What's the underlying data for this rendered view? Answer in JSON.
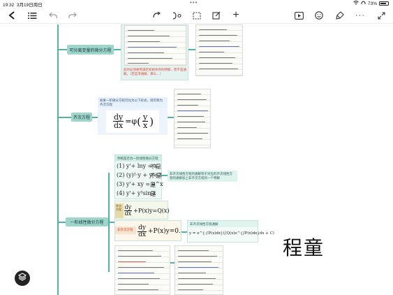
{
  "status": {
    "time": "19:32",
    "date": "3月19日周日",
    "battery": "73%"
  },
  "toolbar": {
    "back": "‹",
    "outline": "☰",
    "undo": "↶",
    "redo": "↷",
    "add": "+",
    "more": "···"
  },
  "topics": {
    "t1": "可分离变量的微分方程",
    "t2": "齐次方程",
    "t3": "一阶线性微分方程"
  },
  "notes": {
    "t1_red": "此时必须要用满足初始条件的特解，而不是通解。（若是求通解，那么…）",
    "t2_desc": "如果一阶微分方程可化为以下形式，则可称为齐次方程",
    "t3_header": "判断是否为一阶线性微分方程",
    "t3_note1": "非齐次线性方程的通解等于对应的齐次线性方程的通解加上非齐次方程的一个特解",
    "t3_homog": "齐次方程",
    "t3_homog2": "非齐次方程",
    "t3_general": "非齐次线性方程通解"
  },
  "formulas": {
    "homog_lhs_num": "dy",
    "homog_lhs_den": "dx",
    "homog_eq": "=φ",
    "homog_rhs_num": "y",
    "homog_rhs_den": "x",
    "linear_num": "dy",
    "linear_den": "dx",
    "linear_rest": "+P(x)y=Q(x)",
    "linear0_rest": "+P(x)y=0.",
    "general": "y = e^{-∫P(x)dx}(∫Q(x)e^{∫P(x)dx}dx + C)"
  },
  "checklist": [
    {
      "eq": "(1) y'+ lny = x",
      "ans": "不是"
    },
    {
      "eq": "(2) (y)²·y + y'=3",
      "ans": "不是"
    },
    {
      "eq": "(3) y'+ xy = e^x",
      "ans": "是"
    },
    {
      "eq": "(4) y'+ y³sin x",
      "ans": "是"
    }
  ],
  "signature": "程童",
  "colors": {
    "branch": "#4fb3a9",
    "topic": "#9fd6cc",
    "card": "#e4f3ef",
    "accent": "#e0453a"
  }
}
